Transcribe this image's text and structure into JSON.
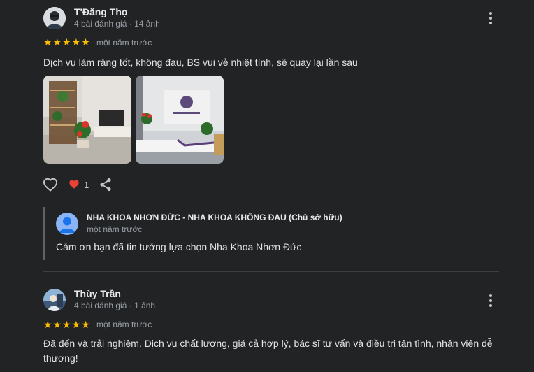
{
  "reviews": [
    {
      "author": "T'Đăng Thọ",
      "meta": "4 bài đánh giá · 14 ảnh",
      "stars": "★★★★★",
      "time": "một năm trước",
      "text": "Dịch vụ làm răng tốt, không đau, BS vui vẻ nhiệt tình, sẽ quay lại lần sau",
      "photos": [
        "clinic-interior-plants-photo",
        "clinic-reception-desk-photo"
      ],
      "likes": "1",
      "reply": {
        "owner": "NHA KHOA NHƠN ĐỨC - NHA KHOA KHÔNG ĐAU (Chủ sở hữu)",
        "time": "một năm trước",
        "text": "Cảm ơn bạn đã tin tưởng lựa chọn Nha Khoa Nhơn Đức"
      }
    },
    {
      "author": "Thùy Trần",
      "meta": "4 bài đánh giá · 1 ảnh",
      "stars": "★★★★★",
      "time": "một năm trước",
      "text": "Đã đến và trải nghiệm. Dịch vụ chất lượng, giá cả hợp lý, bác sĩ tư vấn và điều trị tận tình, nhân viên dễ thương!"
    }
  ],
  "colors": {
    "background": "#222325",
    "star": "#fbbc04",
    "heart": "#ea4335",
    "owner_avatar": "#8ab4f8"
  }
}
